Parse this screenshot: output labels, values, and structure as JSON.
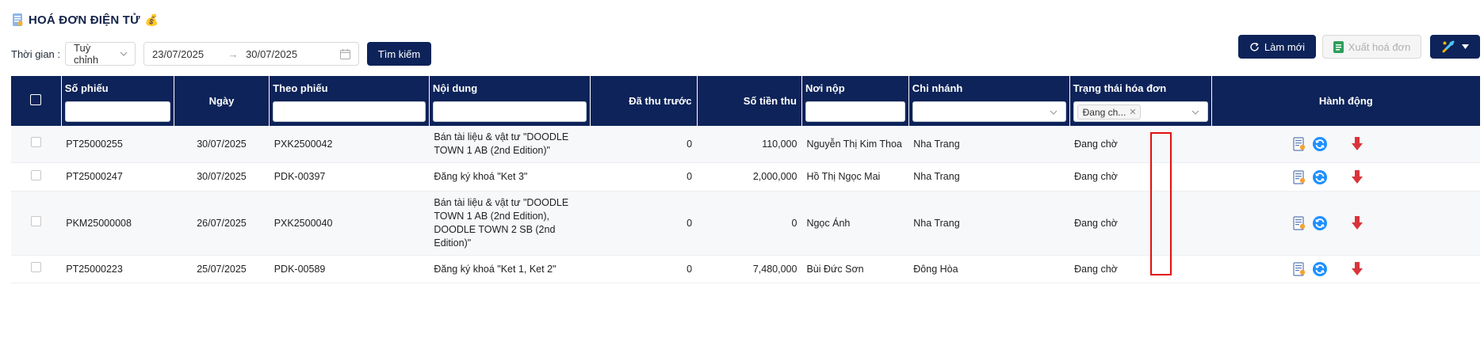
{
  "header": {
    "title": "HOÁ ĐƠN ĐIỆN TỬ",
    "title_emoji": "💰"
  },
  "filters": {
    "time_label": "Thời gian :",
    "time_mode": "Tuỳ chỉnh",
    "date_from": "23/07/2025",
    "date_separator": "→",
    "date_to": "30/07/2025",
    "search_label": "Tìm kiếm"
  },
  "toolbar": {
    "refresh_label": "Làm mới",
    "export_label": "Xuất hoá đơn"
  },
  "table": {
    "columns": {
      "so_phieu": "Số phiếu",
      "ngay": "Ngày",
      "theo_phieu": "Theo phiếu",
      "noi_dung": "Nội dung",
      "da_thu_truoc": "Đã thu trước",
      "so_tien_thu": "Số tiền thu",
      "noi_nop": "Nơi nộp",
      "chi_nhanh": "Chi nhánh",
      "trang_thai": "Trạng thái hóa đơn",
      "hanh_dong": "Hành động"
    },
    "status_filter_tag": "Đang ch...",
    "rows": [
      {
        "so_phieu": "PT25000255",
        "ngay": "30/07/2025",
        "theo_phieu": "PXK2500042",
        "noi_dung": "Bán tài liệu & vật tư \"DOODLE TOWN 1 AB (2nd Edition)\"",
        "da_thu_truoc": "0",
        "so_tien_thu": "110,000",
        "noi_nop": "Nguyễn Thị Kim Thoa",
        "chi_nhanh": "Nha Trang",
        "trang_thai": "Đang chờ"
      },
      {
        "so_phieu": "PT25000247",
        "ngay": "30/07/2025",
        "theo_phieu": "PDK-00397",
        "noi_dung": "Đăng ký khoá \"Ket 3\"",
        "da_thu_truoc": "0",
        "so_tien_thu": "2,000,000",
        "noi_nop": "Hồ Thị Ngọc Mai",
        "chi_nhanh": "Nha Trang",
        "trang_thai": "Đang chờ"
      },
      {
        "so_phieu": "PKM25000008",
        "ngay": "26/07/2025",
        "theo_phieu": "PXK2500040",
        "noi_dung": "Bán tài liệu & vật tư \"DOODLE TOWN 1 AB (2nd Edition), DOODLE TOWN 2 SB (2nd Edition)\"",
        "da_thu_truoc": "0",
        "so_tien_thu": "0",
        "noi_nop": "Ngọc Ánh",
        "chi_nhanh": "Nha Trang",
        "trang_thai": "Đang chờ"
      },
      {
        "so_phieu": "PT25000223",
        "ngay": "25/07/2025",
        "theo_phieu": "PDK-00589",
        "noi_dung": "Đăng ký khoá \"Ket 1, Ket 2\"",
        "da_thu_truoc": "0",
        "so_tien_thu": "7,480,000",
        "noi_nop": "Bùi Đức Sơn",
        "chi_nhanh": "Đông Hòa",
        "trang_thai": "Đang chờ"
      }
    ]
  },
  "colors": {
    "navy": "#0d2359",
    "highlight": "#e01010",
    "download": "#d9343a",
    "sync": "#1e90ff"
  }
}
